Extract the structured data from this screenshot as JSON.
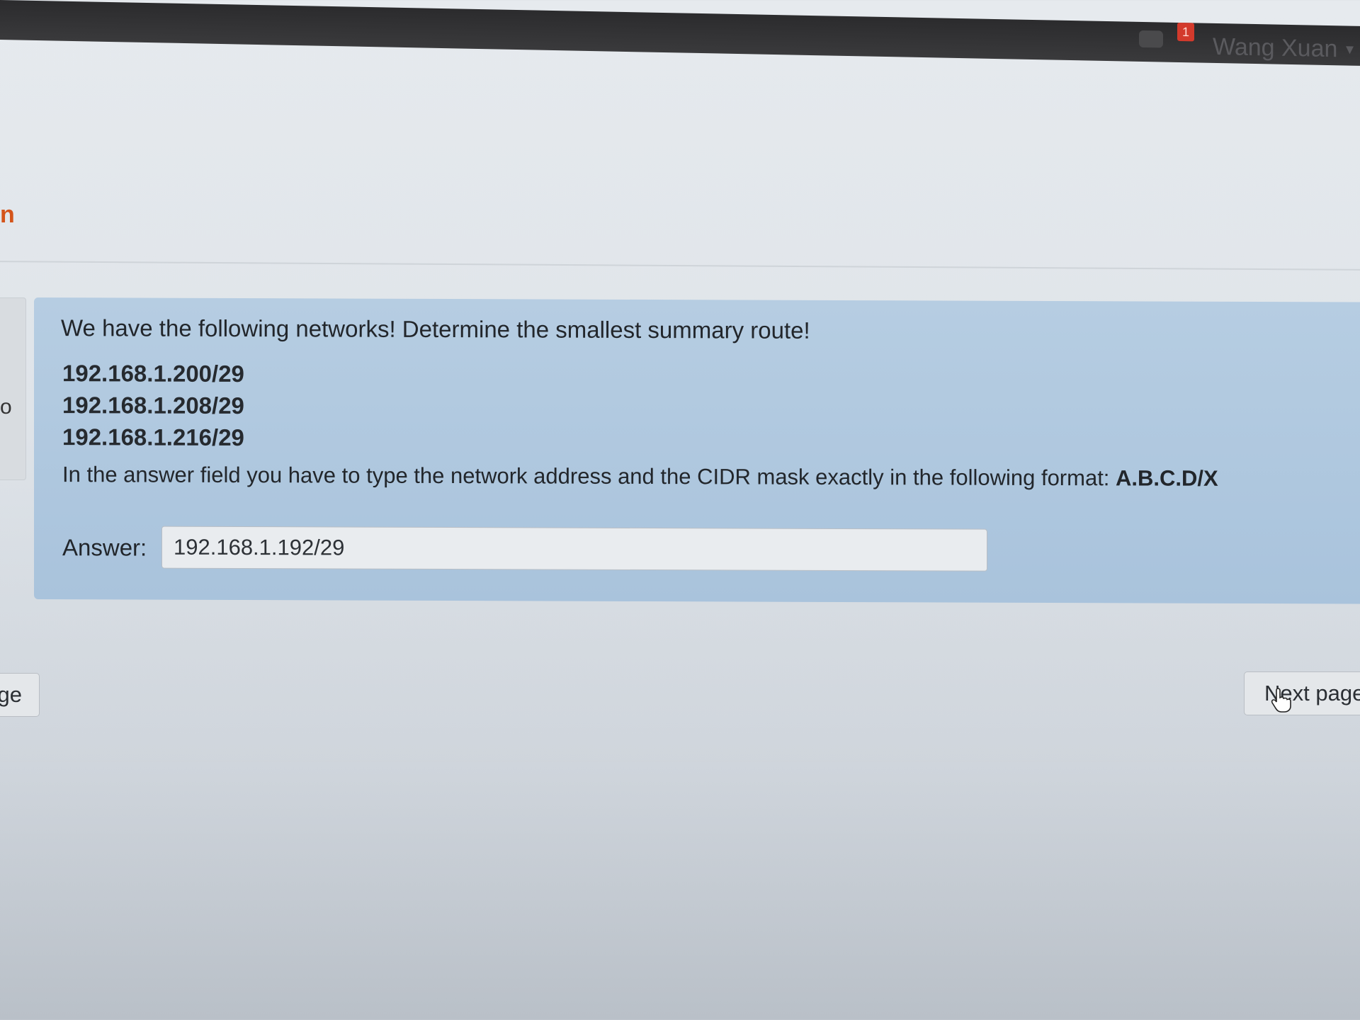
{
  "topbar": {
    "notification_count": "1",
    "user_name": "Wang Xuan",
    "chat_icon": "chat-bubble-icon",
    "caret_icon": "chevron-down-icon"
  },
  "header": {
    "brand_fragment": "n"
  },
  "side": {
    "glyph": "o"
  },
  "question": {
    "title": "We have the following networks! Determine the smallest summary route!",
    "networks": [
      "192.168.1.200/29",
      "192.168.1.208/29",
      "192.168.1.216/29"
    ],
    "instructions": "In the answer field you have to type the network address and the CIDR mask exactly in the following format:",
    "format": "A.B.C.D/X",
    "answer_label": "Answer:",
    "answer_value": "192.168.1.192/29"
  },
  "nav": {
    "prev_label": "ge",
    "next_label": "Next page"
  },
  "colors": {
    "question_bg": "#b0c8df",
    "brand": "#d4541a",
    "badge": "#d33a2c"
  }
}
